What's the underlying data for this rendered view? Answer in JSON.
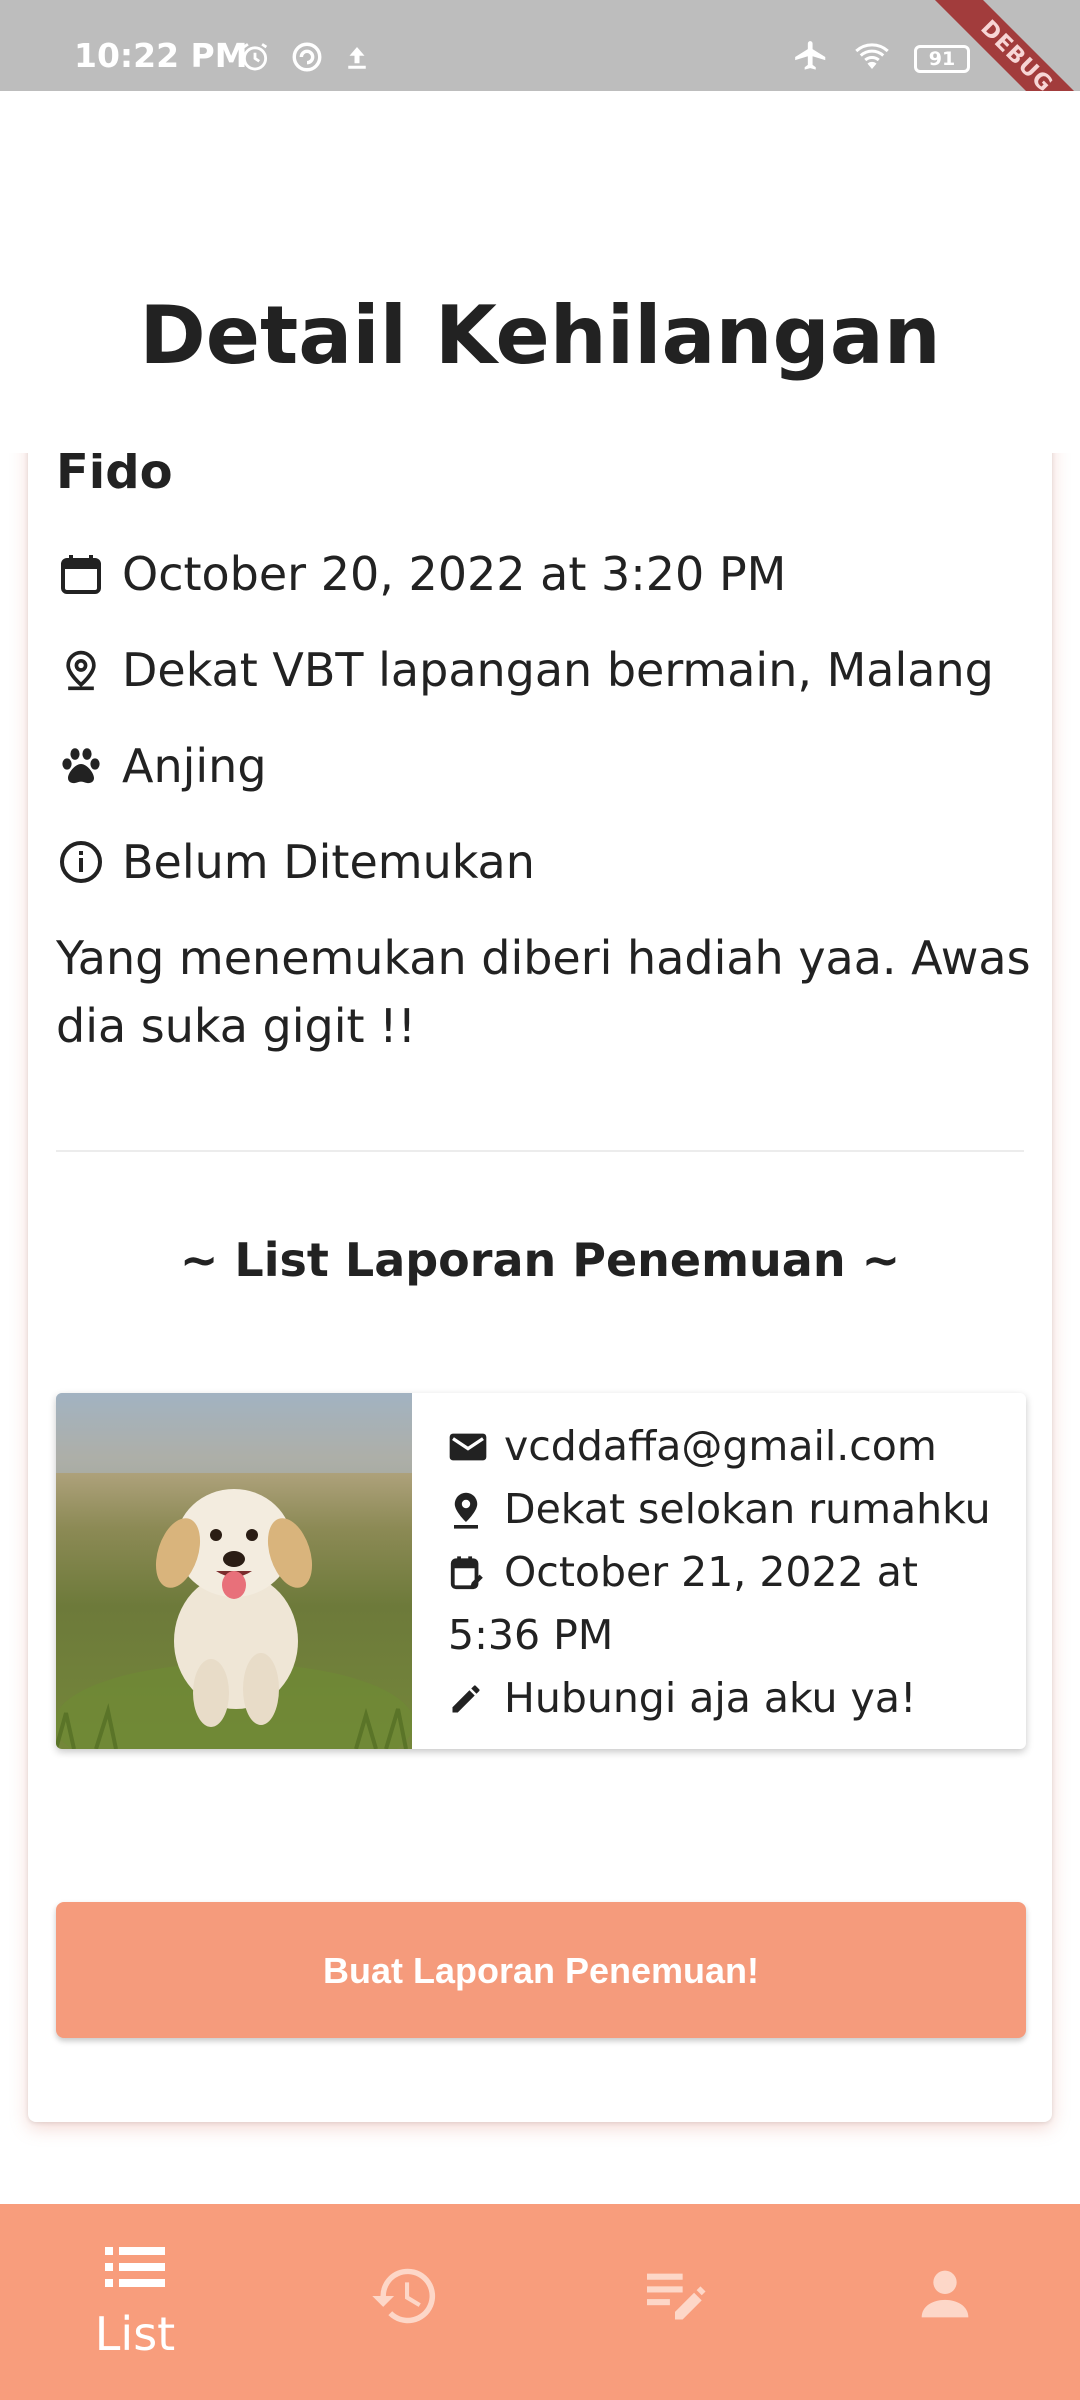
{
  "status_bar": {
    "time": "10:22 PM",
    "battery": "91",
    "debug_label": "DEBUG"
  },
  "header": {
    "title": "Detail Kehilangan"
  },
  "pet": {
    "name": "Fido",
    "date": "October 20, 2022 at 3:20 PM",
    "location": "Dekat VBT lapangan bermain, Malang",
    "species": "Anjing",
    "status": "Belum Ditemukan",
    "description": "Yang menemukan diberi hadiah yaa. Awas dia suka gigit !!"
  },
  "reports_section": {
    "title": "~ List Laporan Penemuan ~",
    "items": [
      {
        "email": "vcddaffa@gmail.com",
        "location": "Dekat selokan rumahku",
        "date": "October 21, 2022 at 5:36 PM",
        "note": "Hubungi aja aku ya!"
      }
    ]
  },
  "actions": {
    "create_report_label": "Buat Laporan Penemuan!"
  },
  "bottom_nav": {
    "items": [
      {
        "label": "List",
        "icon": "list-icon",
        "active": true
      },
      {
        "label": "",
        "icon": "history-icon",
        "active": false
      },
      {
        "label": "",
        "icon": "edit-note-icon",
        "active": false
      },
      {
        "label": "",
        "icon": "person-icon",
        "active": false
      }
    ]
  },
  "colors": {
    "accent": "#f89d7c",
    "button": "#f59b7c",
    "status_bar": "#bdbdbd",
    "text": "#222222"
  }
}
